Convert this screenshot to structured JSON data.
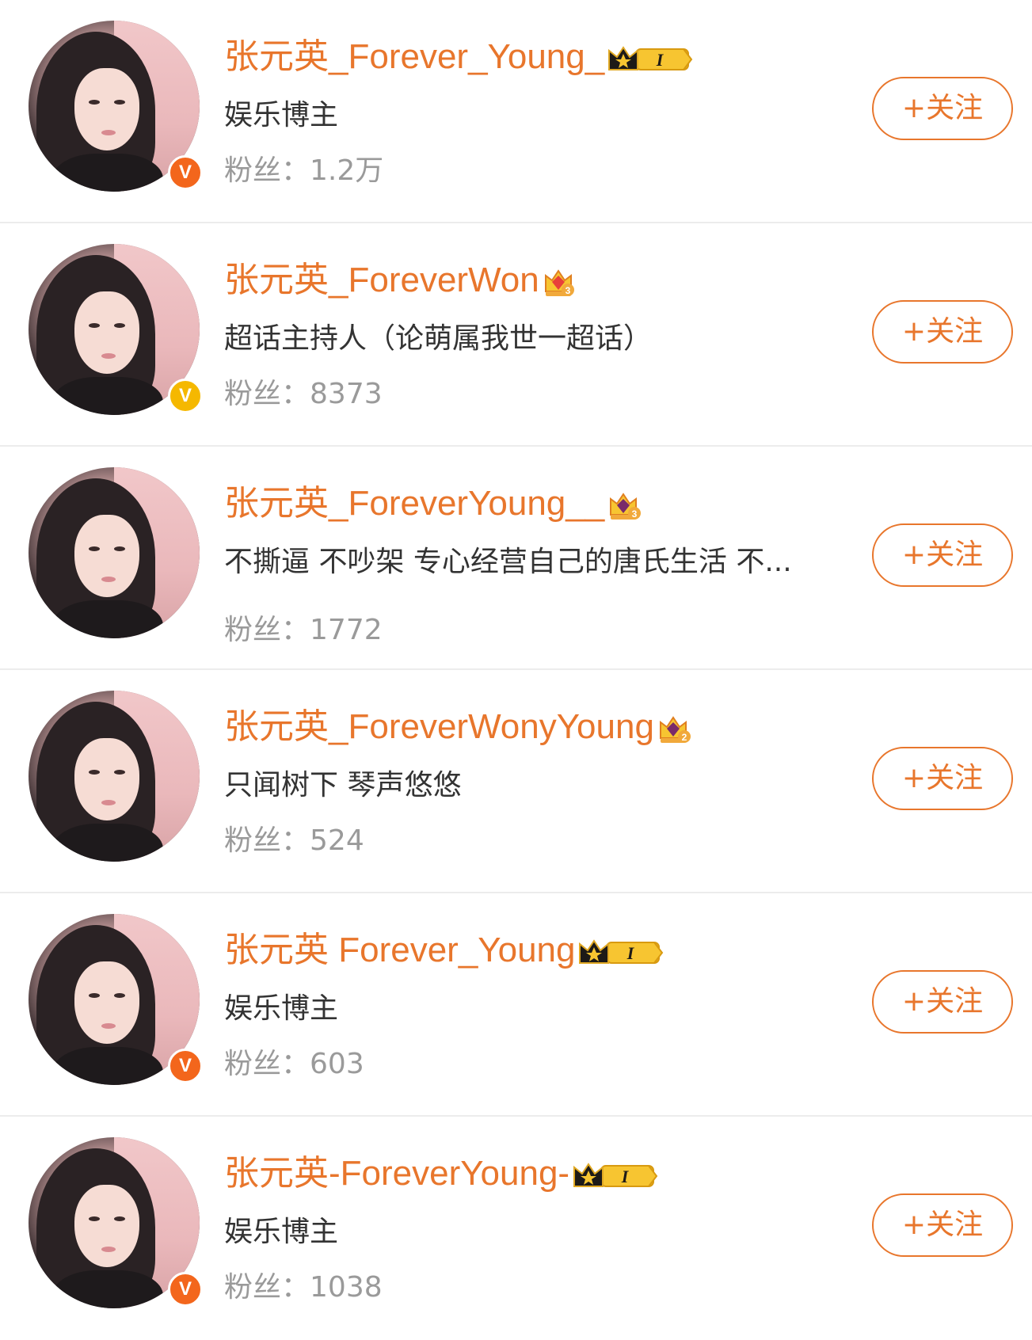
{
  "accent_color": "#e8762c",
  "users": [
    {
      "name": "张元英_Forever_Young_",
      "description": "娱乐博主",
      "fans_label": "粉丝：",
      "fans_count": "1.2万",
      "follow_label": "+关注",
      "verified_badge": "orange-v-badge",
      "verified_letter": "V",
      "verified_color": "#f3661c",
      "rank_badge": "crown-level-badge",
      "rank_text": "I"
    },
    {
      "name": "张元英_ForeverWon",
      "description": "超话主持人（论萌属我世一超话）",
      "fans_label": "粉丝：",
      "fans_count": "8373",
      "follow_label": "+关注",
      "verified_badge": "yellow-v-badge",
      "verified_letter": "V",
      "verified_color": "#f5b800",
      "rank_badge": "gem-crown-badge",
      "rank_text": "3"
    },
    {
      "name": "张元英_ForeverYoung__",
      "description": "不撕逼 不吵架 专心经营自己的唐氏生活 不...",
      "fans_label": "粉丝：",
      "fans_count": "1772",
      "follow_label": "+关注",
      "verified_badge": "",
      "verified_letter": "",
      "verified_color": "",
      "rank_badge": "gem-crown-badge",
      "rank_text": "3"
    },
    {
      "name": "张元英_ForeverWonyYoung",
      "description": "只闻树下 琴声悠悠",
      "fans_label": "粉丝：",
      "fans_count": "524",
      "follow_label": "+关注",
      "verified_badge": "",
      "verified_letter": "",
      "verified_color": "",
      "rank_badge": "gem-crown-badge",
      "rank_text": "2"
    },
    {
      "name": "张元英 Forever_Young",
      "description": "娱乐博主",
      "fans_label": "粉丝：",
      "fans_count": "603",
      "follow_label": "+关注",
      "verified_badge": "orange-v-badge",
      "verified_letter": "V",
      "verified_color": "#f3661c",
      "rank_badge": "crown-level-badge",
      "rank_text": "I"
    },
    {
      "name": "张元英-ForeverYoung-",
      "description": "娱乐博主",
      "fans_label": "粉丝：",
      "fans_count": "1038",
      "follow_label": "+关注",
      "verified_badge": "orange-v-badge",
      "verified_letter": "V",
      "verified_color": "#f3661c",
      "rank_badge": "crown-level-badge",
      "rank_text": "I"
    }
  ]
}
